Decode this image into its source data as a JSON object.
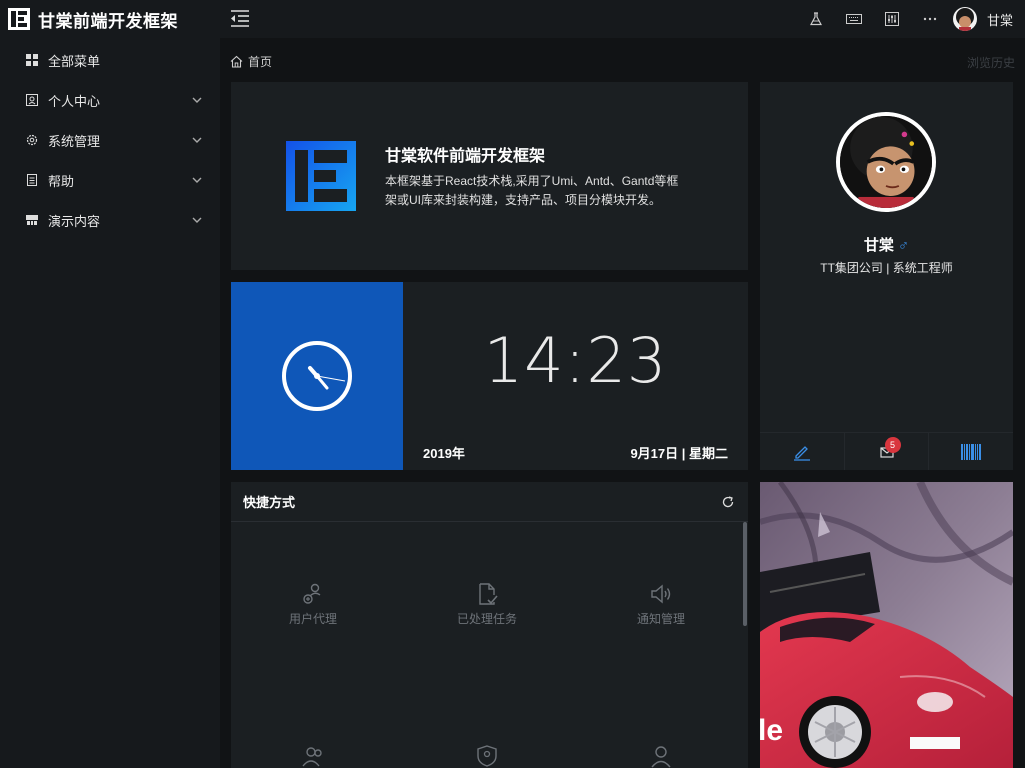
{
  "brand": {
    "title": "甘棠前端开发框架"
  },
  "sidebar": {
    "items": [
      {
        "label": "全部菜单",
        "icon": "grid-icon"
      },
      {
        "label": "个人中心",
        "icon": "user-card-icon"
      },
      {
        "label": "系统管理",
        "icon": "gear-icon"
      },
      {
        "label": "帮助",
        "icon": "doc-icon"
      },
      {
        "label": "演示内容",
        "icon": "demo-icon"
      }
    ]
  },
  "topbar": {
    "icons": [
      "flask-icon",
      "keyboard-icon",
      "settings-sliders-icon",
      "more-icon"
    ],
    "user_name": "甘棠"
  },
  "breadcrumb": {
    "home": "首页",
    "history": "浏览历史"
  },
  "intro": {
    "title": "甘棠软件前端开发框架",
    "desc": "本框架基于React技术栈,采用了Umi、Antd、Gantd等框架或UI库来封装构建，支持产品、项目分模块开发。"
  },
  "clock": {
    "time": "14:23",
    "year": "2019年",
    "date": "9月17日 | 星期二"
  },
  "profile": {
    "name": "甘棠",
    "gender_symbol": "♂",
    "subtitle": "TT集团公司 | 系统工程师",
    "message_count": "5"
  },
  "shortcuts": {
    "title": "快捷方式",
    "items": [
      {
        "label": "用户代理",
        "icon": "user-proxy-icon"
      },
      {
        "label": "已处理任务",
        "icon": "task-done-icon"
      },
      {
        "label": "通知管理",
        "icon": "sound-icon"
      },
      {
        "label": "",
        "icon": "team-icon"
      },
      {
        "label": "",
        "icon": "shield-user-icon"
      },
      {
        "label": "",
        "icon": "user-icon"
      }
    ]
  },
  "colors": {
    "accent": "#0f57b8",
    "link": "#3a8ee6",
    "badge": "#d9363e"
  }
}
